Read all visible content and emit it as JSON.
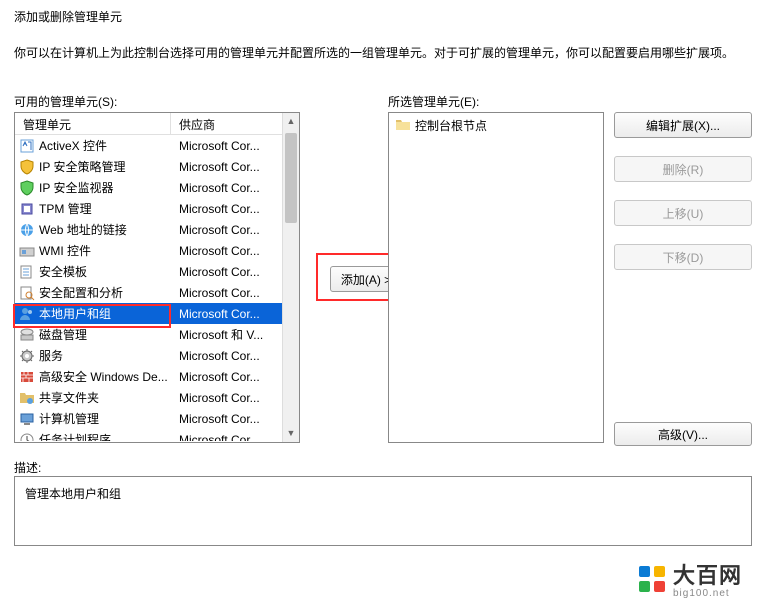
{
  "dialog": {
    "title": "添加或删除管理单元",
    "instruction": "你可以在计算机上为此控制台选择可用的管理单元并配置所选的一组管理单元。对于可扩展的管理单元，你可以配置要启用哪些扩展项。"
  },
  "labels": {
    "available": "可用的管理单元(S):",
    "selected": "所选管理单元(E):",
    "description": "描述:"
  },
  "available": {
    "headers": {
      "name": "管理单元",
      "vendor": "供应商"
    },
    "items": [
      {
        "name": "ActiveX 控件",
        "vendor": "Microsoft Cor...",
        "icon": "activex"
      },
      {
        "name": "IP 安全策略管理",
        "vendor": "Microsoft Cor...",
        "icon": "shield-yellow"
      },
      {
        "name": "IP 安全监视器",
        "vendor": "Microsoft Cor...",
        "icon": "shield-green"
      },
      {
        "name": "TPM 管理",
        "vendor": "Microsoft Cor...",
        "icon": "chip"
      },
      {
        "name": "Web 地址的链接",
        "vendor": "Microsoft Cor...",
        "icon": "link"
      },
      {
        "name": "WMI 控件",
        "vendor": "Microsoft Cor...",
        "icon": "wmi"
      },
      {
        "name": "安全模板",
        "vendor": "Microsoft Cor...",
        "icon": "template"
      },
      {
        "name": "安全配置和分析",
        "vendor": "Microsoft Cor...",
        "icon": "analyze"
      },
      {
        "name": "本地用户和组",
        "vendor": "Microsoft Cor...",
        "icon": "users",
        "selected": true
      },
      {
        "name": "磁盘管理",
        "vendor": "Microsoft 和 V...",
        "icon": "disk"
      },
      {
        "name": "服务",
        "vendor": "Microsoft Cor...",
        "icon": "gear"
      },
      {
        "name": "高级安全 Windows De...",
        "vendor": "Microsoft Cor...",
        "icon": "firewall"
      },
      {
        "name": "共享文件夹",
        "vendor": "Microsoft Cor...",
        "icon": "folder-share"
      },
      {
        "name": "计算机管理",
        "vendor": "Microsoft Cor...",
        "icon": "computer"
      },
      {
        "name": "任务计划程序",
        "vendor": "Microsoft Cor...",
        "icon": "clock"
      }
    ]
  },
  "selected": {
    "rootLabel": "控制台根节点"
  },
  "buttons": {
    "add": "添加(A) >",
    "editExt": "编辑扩展(X)...",
    "remove": "删除(R)",
    "moveUp": "上移(U)",
    "moveDown": "下移(D)",
    "advanced": "高级(V)..."
  },
  "description": {
    "text": "管理本地用户和组"
  },
  "watermark": {
    "brand": "大百网",
    "sub": "big100.net"
  }
}
